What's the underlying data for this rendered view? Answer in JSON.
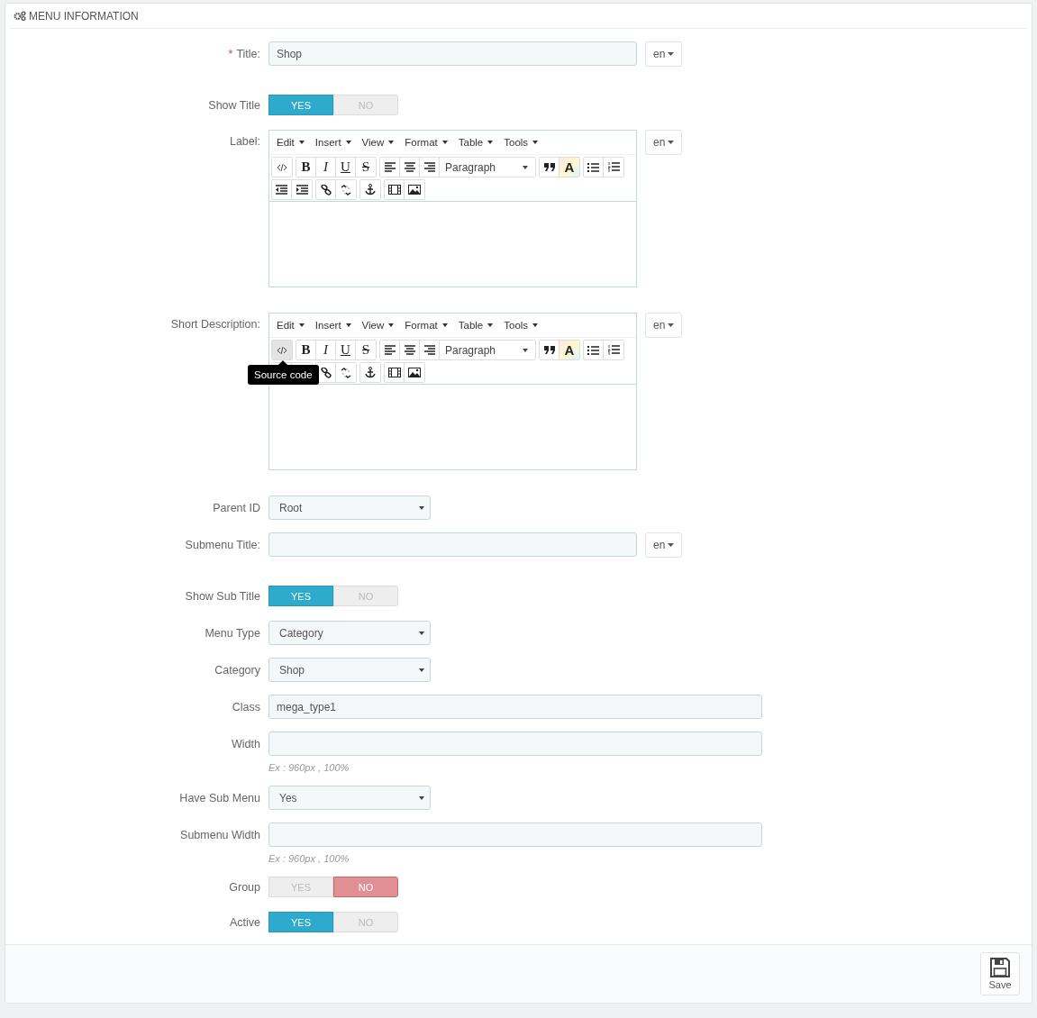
{
  "panel": {
    "title": "MENU INFORMATION"
  },
  "fields": [
    {
      "kind": "text",
      "label": "Title:",
      "required_mark": "*",
      "value": "Shop",
      "translatable": true,
      "language": "en"
    },
    {
      "kind": "switch",
      "label": "Show Title",
      "options": [
        {
          "label": "YES",
          "selected": true
        },
        {
          "label": "NO",
          "selected": false
        }
      ]
    },
    {
      "kind": "editor",
      "label": "Label:",
      "translatable": true,
      "language": "en",
      "menus": [
        "Edit",
        "Insert",
        "View",
        "Format",
        "Table",
        "Tools"
      ],
      "style_buttons": [
        "B",
        "I",
        "U",
        "S"
      ],
      "block_format": "Paragraph",
      "text_color_button": "A"
    },
    {
      "kind": "editor",
      "label": "Short Description:",
      "translatable": true,
      "language": "en",
      "menus": [
        "Edit",
        "Insert",
        "View",
        "Format",
        "Table",
        "Tools"
      ],
      "style_buttons": [
        "B",
        "I",
        "U",
        "S"
      ],
      "block_format": "Paragraph",
      "text_color_button": "A",
      "tooltip": "Source code"
    },
    {
      "kind": "select",
      "label": "Parent ID",
      "value": "Root"
    },
    {
      "kind": "text",
      "label": "Submenu Title:",
      "translatable": true,
      "language": "en"
    },
    {
      "kind": "switch",
      "label": "Show Sub Title",
      "options": [
        {
          "label": "YES",
          "selected": true
        },
        {
          "label": "NO",
          "selected": false
        }
      ]
    },
    {
      "kind": "select",
      "label": "Menu Type",
      "value": "Category"
    },
    {
      "kind": "select",
      "label": "Category",
      "value": "Shop"
    },
    {
      "kind": "text",
      "label": "Class",
      "value": "mega_type1",
      "translatable": false
    },
    {
      "kind": "text",
      "label": "Width",
      "translatable": false,
      "hint": "Ex : 960px , 100%"
    },
    {
      "kind": "select",
      "label": "Have Sub Menu",
      "value": "Yes"
    },
    {
      "kind": "text",
      "label": "Submenu Width",
      "translatable": false,
      "hint": "Ex : 960px , 100%"
    },
    {
      "kind": "switch",
      "label": "Group",
      "options": [
        {
          "label": "YES",
          "selected": false
        },
        {
          "label": "NO",
          "selected": true
        }
      ]
    },
    {
      "kind": "switch",
      "label": "Active",
      "options": [
        {
          "label": "YES",
          "selected": true
        },
        {
          "label": "NO",
          "selected": false
        }
      ]
    }
  ],
  "footer": {
    "save_button": "Save"
  }
}
